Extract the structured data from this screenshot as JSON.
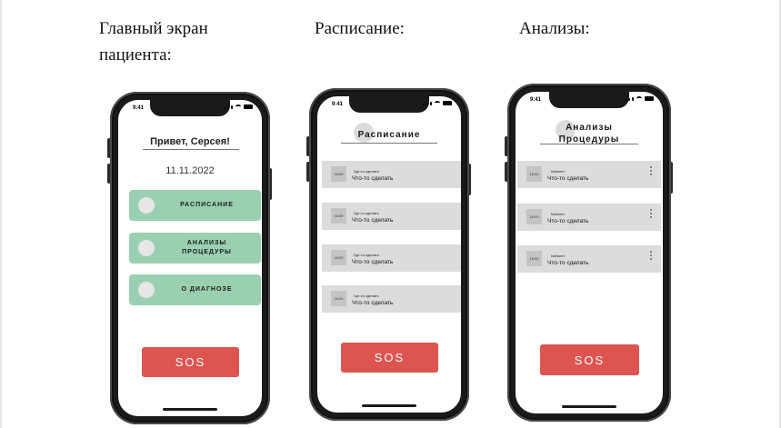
{
  "captions": {
    "home": "Главный экран\nпациента:",
    "schedule": "Расписание:",
    "analyses": "Анализы:"
  },
  "status_time": "9:41",
  "home_screen": {
    "greeting": "Привет, Серсея!",
    "date": "11.11.2022",
    "menu": [
      {
        "label": "РАСПИСАНИЕ"
      },
      {
        "label": "АНАЛИЗЫ\nПРОЦЕДУРЫ"
      },
      {
        "label": "О ДИАГНОЗЕ"
      }
    ],
    "sos_label": "SOS"
  },
  "schedule_screen": {
    "title": "Расписание",
    "items": [
      {
        "time": "16:00",
        "place": "Где-то сделать",
        "task": "Что-то сделать"
      },
      {
        "time": "16:00",
        "place": "Где-то сделать",
        "task": "Что-то сделать"
      },
      {
        "time": "16:00",
        "place": "Где-то сделать",
        "task": "Что-то сделать"
      },
      {
        "time": "16:00",
        "place": "Где-то сделать",
        "task": "Что-то сделать"
      }
    ],
    "sos_label": "SOS"
  },
  "analyses_screen": {
    "title": "Анализы\nПроцедуры",
    "items": [
      {
        "time": "16:00",
        "place": "Кабинет",
        "task": "Что-то сделать"
      },
      {
        "time": "16:00",
        "place": "Кабинет",
        "task": "Что-то сделать"
      },
      {
        "time": "16:00",
        "place": "Кабинет",
        "task": "Что-то сделать"
      }
    ],
    "sos_label": "SOS"
  },
  "colors": {
    "menu_green": "#9ad0b1",
    "sos_red": "#dd5551",
    "row_gray": "#dcdcdc",
    "phone_frame": "#1a1a1a"
  }
}
